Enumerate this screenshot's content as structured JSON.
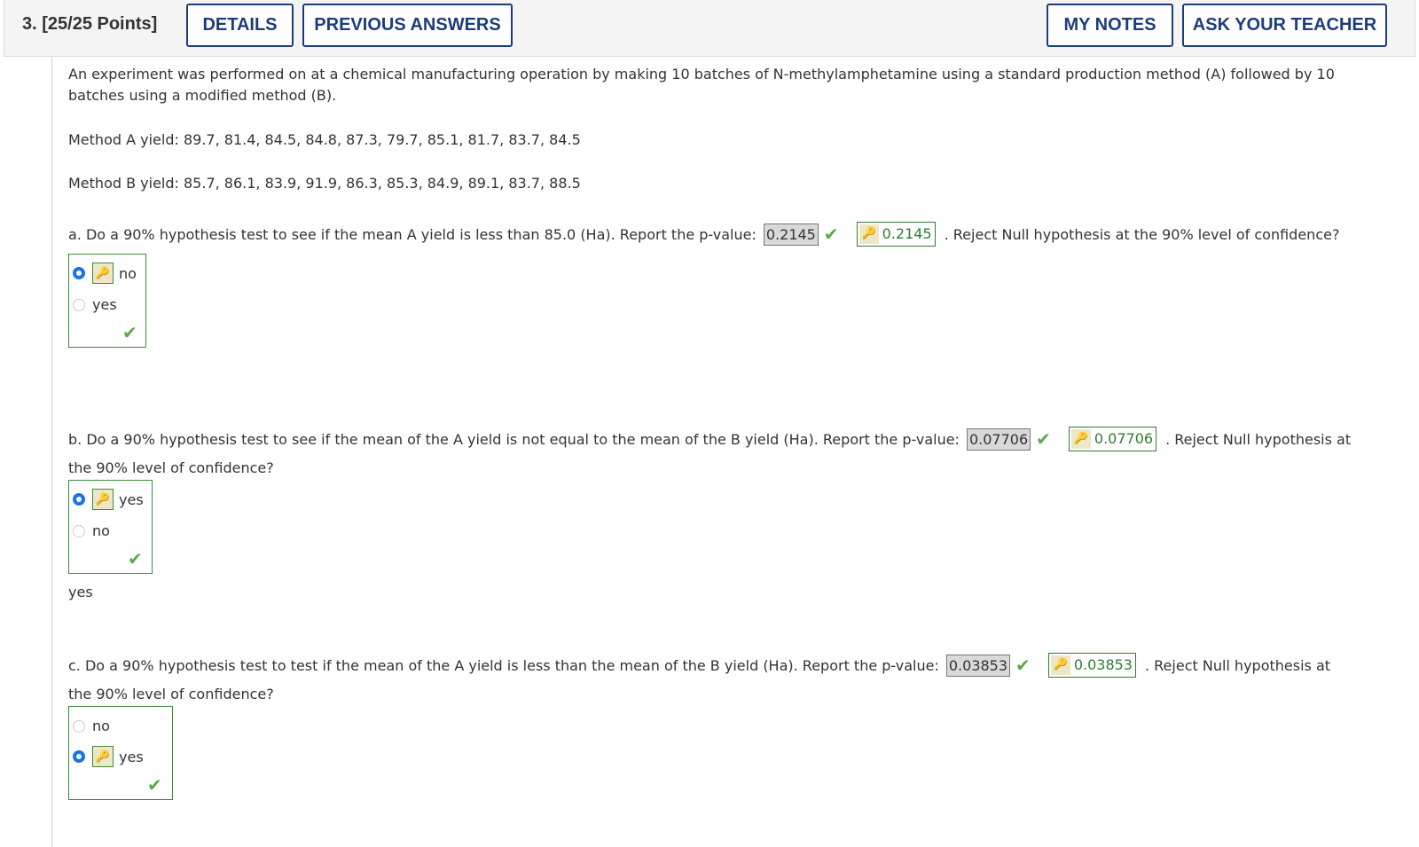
{
  "header": {
    "question_label": "3. [25/25 Points]",
    "details_label": "DETAILS",
    "previous_answers_label": "PREVIOUS ANSWERS",
    "my_notes_label": "MY NOTES",
    "ask_teacher_label": "ASK YOUR TEACHER"
  },
  "problem": {
    "intro_line1": "An experiment was performed on at a chemical manufacturing operation by making 10 batches of N-methylamphetamine using a standard production method (A) followed by 10",
    "intro_line2": "batches using a modified method (B).",
    "method_a": "Method A yield: 89.7, 81.4, 84.5, 84.8, 87.3, 79.7, 85.1, 81.7, 83.7, 84.5",
    "method_b": "Method B yield: 85.7, 86.1, 83.9, 91.9, 86.3, 85.3, 84.9, 89.1, 83.7, 88.5"
  },
  "part_a": {
    "question": "a. Do a 90% hypothesis test to see if the mean A yield is less than 85.0 (Ha). Report the p-value:",
    "answer": "0.2145",
    "key_answer": "0.2145",
    "followup": ". Reject Null hypothesis at the 90% level of confidence?",
    "options": [
      "no",
      "yes"
    ],
    "selected": "no"
  },
  "part_b": {
    "question": "b. Do a 90% hypothesis test to see if the mean of the A yield is not equal to the mean of the B yield (Ha). Report the p-value:",
    "answer": "0.07706",
    "key_answer": "0.07706",
    "followup": ". Reject Null hypothesis at",
    "followup2": "the 90% level of confidence?",
    "options": [
      "yes",
      "no"
    ],
    "selected": "yes",
    "response_text": "yes"
  },
  "part_c": {
    "question": "c. Do a 90% hypothesis test to test if the mean of the A yield is less than the mean of the B yield (Ha). Report the p-value:",
    "answer": "0.03853",
    "key_answer": "0.03853",
    "followup": ". Reject Null hypothesis at",
    "followup2": "the 90% level of confidence?",
    "options": [
      "no",
      "yes"
    ],
    "selected": "yes"
  },
  "icons": {
    "check": "check-icon",
    "key": "key-icon",
    "radio": "radio-icon"
  },
  "colors": {
    "accent": "#1c3d7a",
    "correct": "#2e7d32",
    "check": "#5aa84a",
    "radio_selected": "#1a73e8"
  }
}
